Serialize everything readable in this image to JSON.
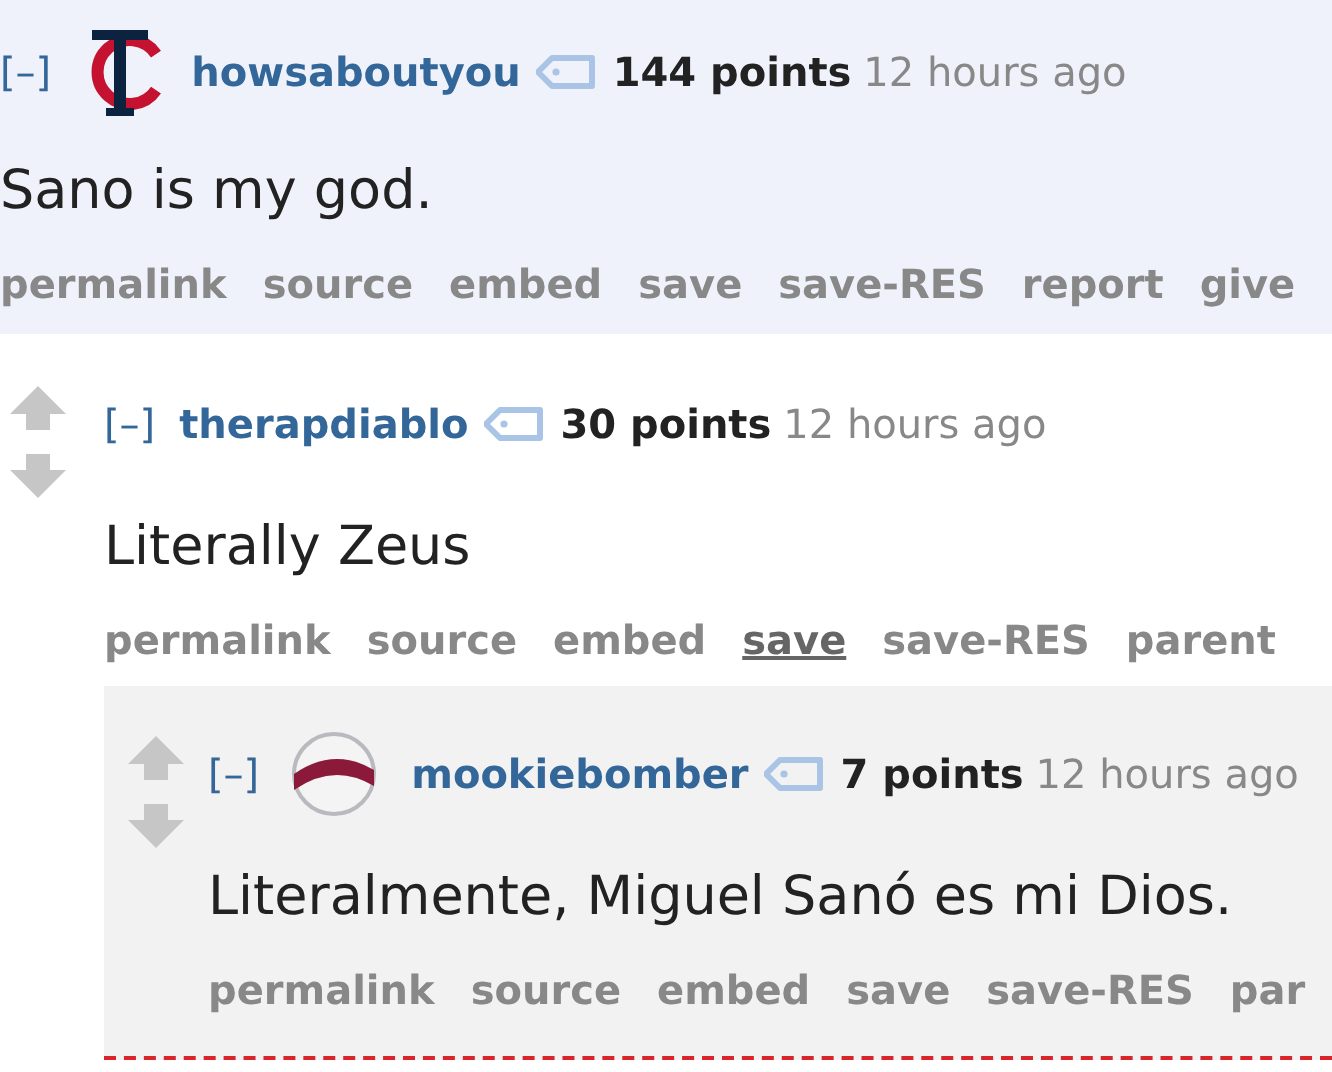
{
  "comments": [
    {
      "collapse": "[–]",
      "flair": {
        "kind": "monogram"
      },
      "author": "howsaboutyou",
      "points": "144 points",
      "time": "12 hours ago",
      "highlighted": true,
      "body": "Sano is my god.",
      "actions": [
        {
          "label": "permalink",
          "hovered": false
        },
        {
          "label": "source",
          "hovered": false
        },
        {
          "label": "embed",
          "hovered": false
        },
        {
          "label": "save",
          "hovered": false
        },
        {
          "label": "save-RES",
          "hovered": false
        },
        {
          "label": "report",
          "hovered": false
        },
        {
          "label": "give",
          "hovered": false
        }
      ],
      "children": [
        {
          "collapse": "[–]",
          "author": "therapdiablo",
          "points": "30 points",
          "time": "12 hours ago",
          "vote_arrows": true,
          "body": "Literally Zeus",
          "actions": [
            {
              "label": "permalink",
              "hovered": false
            },
            {
              "label": "source",
              "hovered": false
            },
            {
              "label": "embed",
              "hovered": false
            },
            {
              "label": "save",
              "hovered": true
            },
            {
              "label": "save-RES",
              "hovered": false
            },
            {
              "label": "parent",
              "hovered": false
            }
          ],
          "children": [
            {
              "collapse": "[–]",
              "flair": {
                "kind": "badge"
              },
              "author": "mookiebomber",
              "points": "7 points",
              "time": "12 hours ago",
              "vote_arrows": true,
              "body": "Literalmente, Miguel Sanó es mi Dios.",
              "actions": [
                {
                  "label": "permalink",
                  "hovered": false
                },
                {
                  "label": "source",
                  "hovered": false
                },
                {
                  "label": "embed",
                  "hovered": false
                },
                {
                  "label": "save",
                  "hovered": false
                },
                {
                  "label": "save-RES",
                  "hovered": false
                },
                {
                  "label": "par",
                  "hovered": false
                }
              ]
            }
          ]
        }
      ]
    }
  ]
}
